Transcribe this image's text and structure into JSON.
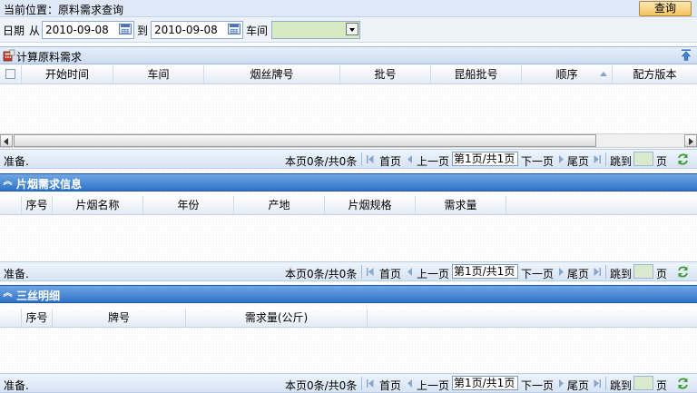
{
  "breadcrumb": {
    "text": "当前位置：原料需求查询"
  },
  "query_button": "查询",
  "filter": {
    "date_label": "日期",
    "from_label": "从",
    "from_value": "2010-09-08",
    "to_label": "到",
    "to_value": "2010-09-08",
    "workshop_label": "车间",
    "workshop_value": ""
  },
  "panel1": {
    "title": "计算原料需求",
    "columns": [
      "开始时间",
      "车间",
      "烟丝牌号",
      "批号",
      "昆船批号",
      "顺序",
      "配方版本"
    ]
  },
  "panel2": {
    "title": "片烟需求信息",
    "columns": [
      "序号",
      "片烟名称",
      "年份",
      "产地",
      "片烟规格",
      "需求量"
    ]
  },
  "panel3": {
    "title": "三丝明细",
    "columns": [
      "序号",
      "牌号",
      "需求量(公斤)"
    ]
  },
  "paging": {
    "status": "准备.",
    "summary": "本页0条/共0条",
    "first": "首页",
    "prev": "上一页",
    "page": "第1页/共1页",
    "next": "下一页",
    "last": "尾页",
    "jump": "跳到",
    "page_unit": "页"
  },
  "icons": [
    "calendar-icon",
    "dropdown-arrow-icon",
    "calculator-icon",
    "collapse-up-icon",
    "collapse-chevron-icon",
    "first-page-icon",
    "prev-page-icon",
    "next-page-icon",
    "last-page-icon",
    "refresh-icon",
    "sort-icon"
  ],
  "colors": {
    "query_button": "#f3c45b",
    "panel_header": "#2f73c8",
    "input_green": "#d8eacb"
  }
}
